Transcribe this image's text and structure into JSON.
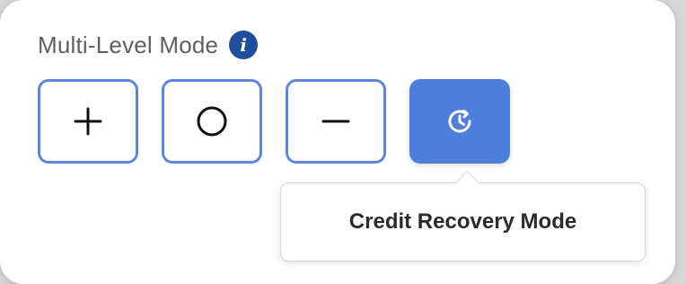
{
  "panel": {
    "title": "Multi-Level Mode",
    "info_icon_glyph": "i"
  },
  "mode_buttons": [
    {
      "name": "plus",
      "icon": "plus-icon",
      "active": false
    },
    {
      "name": "circle",
      "icon": "circle-icon",
      "active": false
    },
    {
      "name": "minus",
      "icon": "minus-icon",
      "active": false
    },
    {
      "name": "credit-recovery",
      "icon": "clock-refresh-icon",
      "active": true
    }
  ],
  "tooltip": {
    "text": "Credit Recovery Mode"
  },
  "colors": {
    "accent": "#4f7fdc",
    "border": "#5a86dd",
    "info": "#1f4e9f",
    "title_text": "#5f5f5f",
    "tooltip_text": "#2b2b2b"
  }
}
